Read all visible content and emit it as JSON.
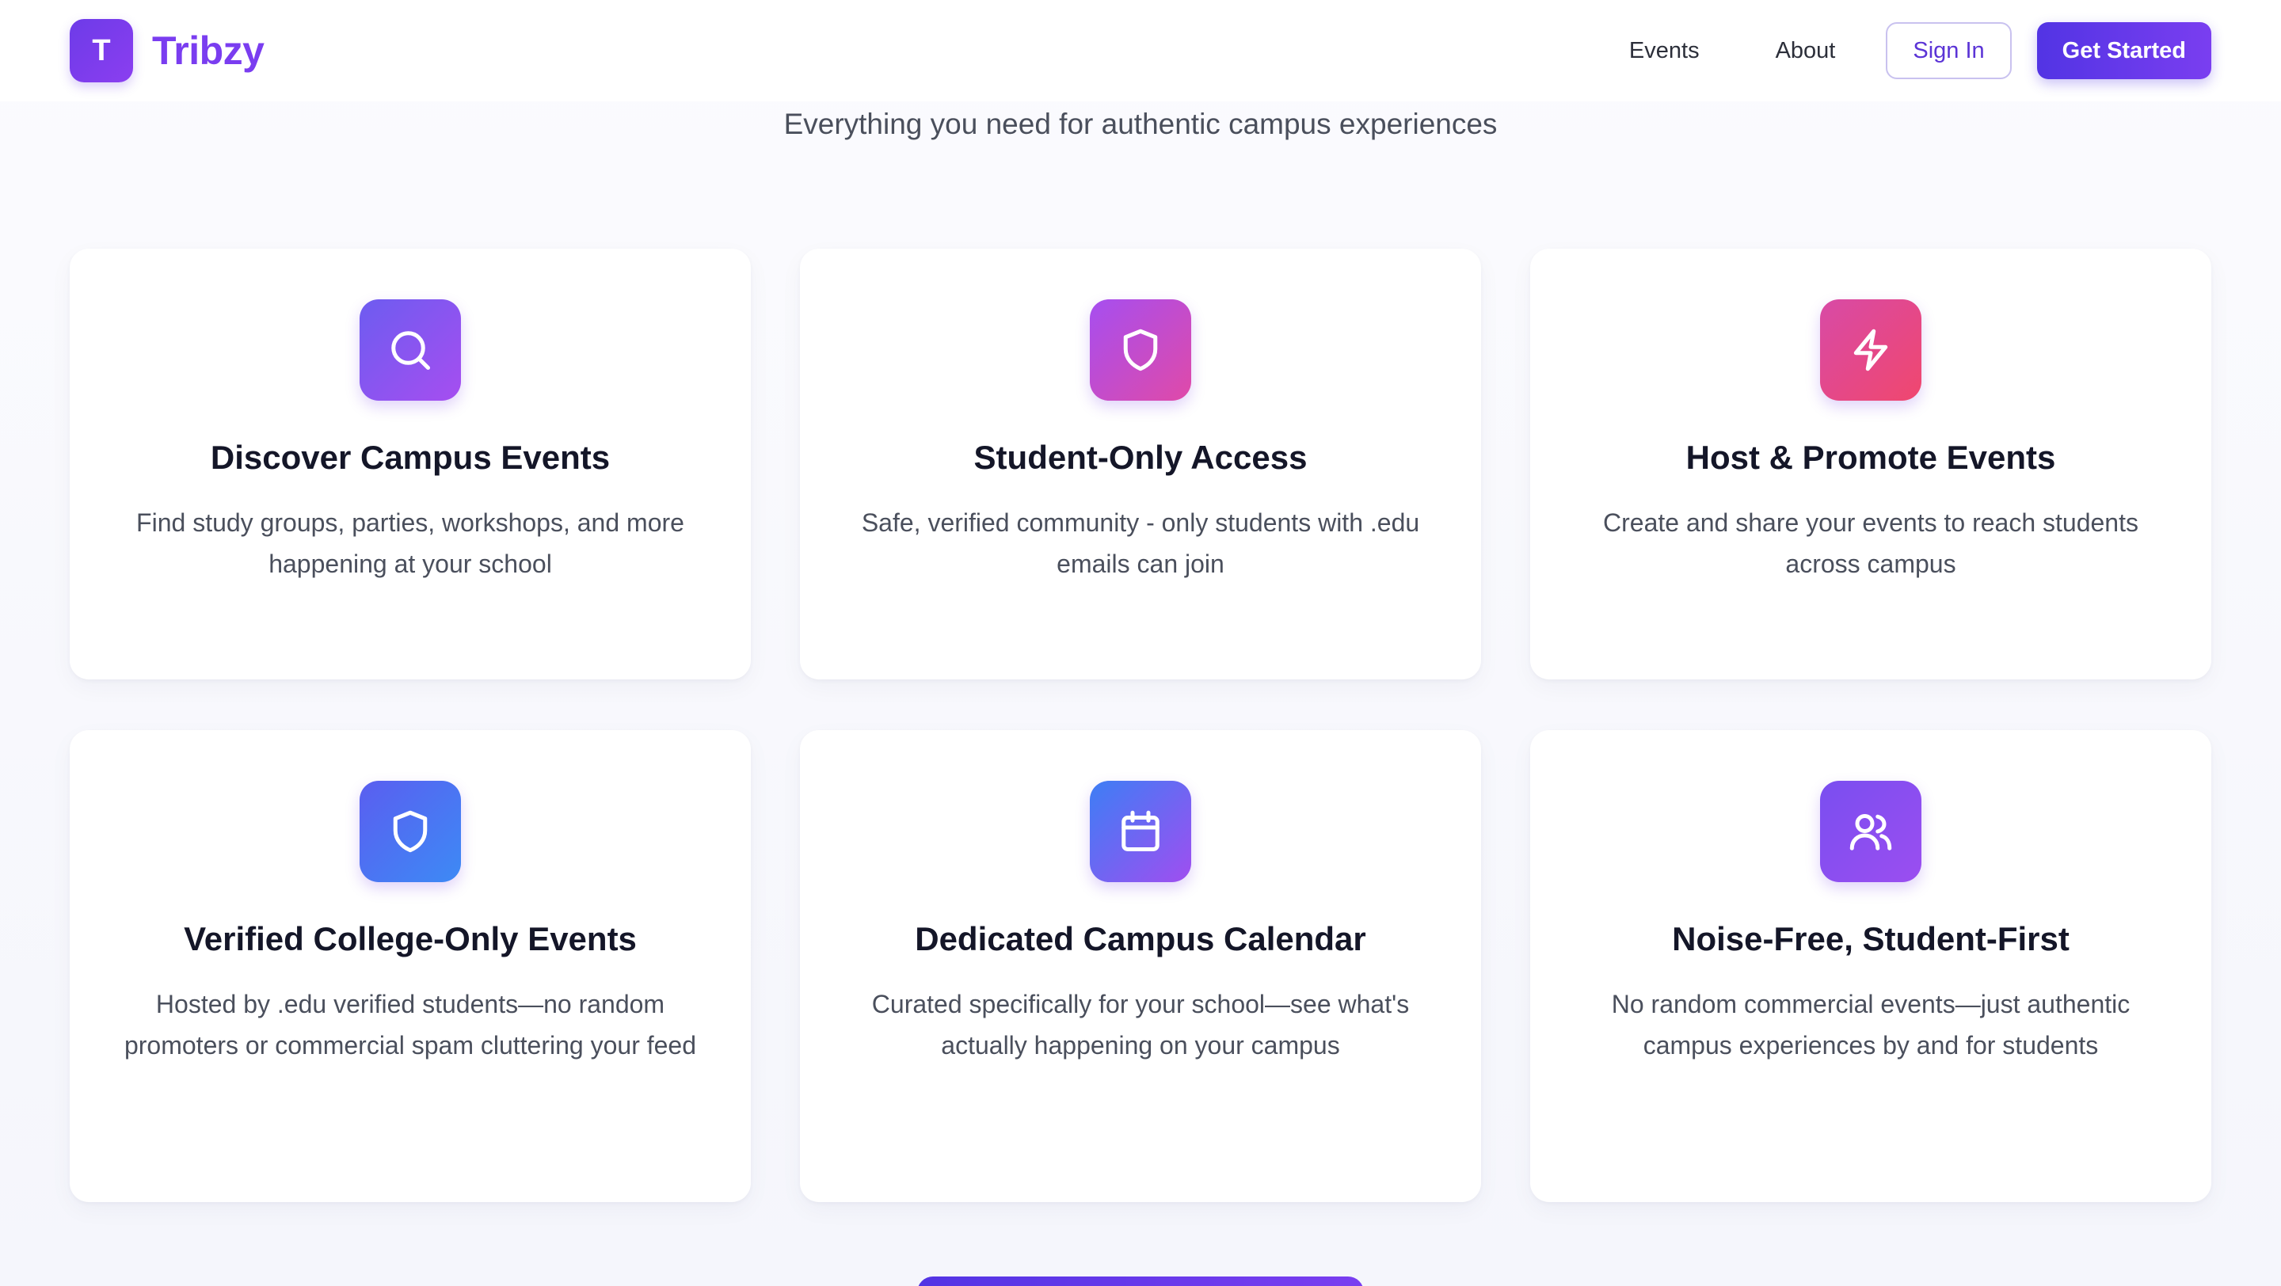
{
  "brand": {
    "logo_letter": "T",
    "name": "Tribzy"
  },
  "nav": {
    "events": "Events",
    "about": "About",
    "sign_in": "Sign In",
    "get_started": "Get Started"
  },
  "subtitle": "Everything you need for authentic campus experiences",
  "features": [
    {
      "icon": "search-icon",
      "title": "Discover Campus Events",
      "description": "Find study groups, parties, workshops, and more happening at your school"
    },
    {
      "icon": "shield-icon",
      "title": "Student-Only Access",
      "description": "Safe, verified community - only students with .edu emails can join"
    },
    {
      "icon": "lightning-icon",
      "title": "Host & Promote Events",
      "description": "Create and share your events to reach students across campus"
    },
    {
      "icon": "shield-icon",
      "title": "Verified College-Only Events",
      "description": "Hosted by .edu verified students—no random promoters or commercial spam cluttering your feed"
    },
    {
      "icon": "calendar-icon",
      "title": "Dedicated Campus Calendar",
      "description": "Curated specifically for your school—see what's actually happening on your campus"
    },
    {
      "icon": "users-icon",
      "title": "Noise-Free, Student-First",
      "description": "No random commercial events—just authentic campus experiences by and for students"
    }
  ],
  "colors": {
    "brand": "#7a3df0",
    "primary_button": "#5234e4",
    "outline_border": "#c9c2ef"
  }
}
